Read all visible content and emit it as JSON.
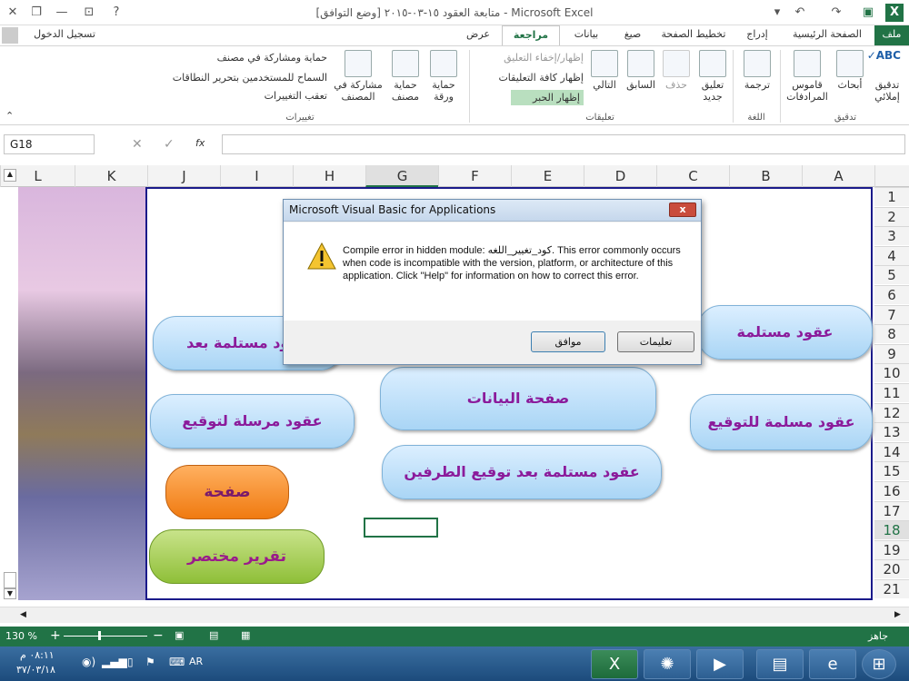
{
  "window": {
    "title": "متابعة العقود ١٥-٠٣-٢٠١٥ [وضع التوافق] - Microsoft Excel",
    "sign_in": "تسجيل الدخول"
  },
  "tabs": [
    {
      "label": "ملف"
    },
    {
      "label": "الصفحة الرئيسية"
    },
    {
      "label": "إدراج"
    },
    {
      "label": "تخطيط الصفحة"
    },
    {
      "label": "صيغ"
    },
    {
      "label": "بيانات"
    },
    {
      "label": "مراجعة"
    },
    {
      "label": "عرض"
    }
  ],
  "ribbon": {
    "spelling": "تدقيق إملائي",
    "research": "أبحاث",
    "thesaurus": "قاموس المرادفات",
    "proofing_group": "تدقيق",
    "translate": "ترجمة",
    "language_group": "اللغة",
    "new_comment": "تعليق جديد",
    "delete": "حذف",
    "previous": "السابق",
    "next": "التالي",
    "show_hide_comment": "إظهار/إخفاء التعليق",
    "show_all_comments": "إظهار كافة التعليقات",
    "show_ink": "إظهار الحبر",
    "comments_group": "تعليقات",
    "protect_sheet": "حماية ورقة",
    "protect_workbook": "حماية مصنف",
    "share_workbook": "مشاركة في المصنف",
    "protect_share": "حماية ومشاركة في مصنف",
    "allow_edit_ranges": "السماح للمستخدمين بتحرير النطاقات",
    "track_changes": "تعقب التغييرات",
    "changes_group": "تغييرات"
  },
  "formula_bar": {
    "name_box": "G18",
    "fx": "fx",
    "content": ""
  },
  "columns": [
    "A",
    "B",
    "C",
    "D",
    "E",
    "F",
    "G",
    "H",
    "I",
    "J",
    "K",
    "L"
  ],
  "rows": [
    "1",
    "2",
    "3",
    "4",
    "5",
    "6",
    "7",
    "8",
    "9",
    "10",
    "11",
    "12",
    "13",
    "14",
    "15",
    "16",
    "17",
    "18",
    "19",
    "20",
    "21"
  ],
  "buttons": {
    "b1": "عقود مستلمة",
    "b2": "عقود مستلمة بعد",
    "b3": "صفحة البيانات",
    "b4": "عقود مسلمة للتوقيع",
    "b5": "عقود مرسلة لتوقيع",
    "b6": "عقود مستلمة بعد توقيع الطرفين",
    "b7": "صفحة",
    "b8": "تقرير مختصر"
  },
  "dialog": {
    "title": "Microsoft Visual Basic for Applications",
    "message": "Compile error in hidden module: كود_تغيير_اللغه. This error commonly occurs when code is incompatible with the version, platform, or architecture of this application.  Click \"Help\" for information on how to correct this error.",
    "ok": "موافق",
    "help": "تعليمات",
    "close": "x"
  },
  "status": {
    "ready": "جاهز",
    "zoom": "130 %"
  },
  "taskbar": {
    "time": "٠٨:١١ م",
    "date": "٣٧/٠٣/١٨",
    "lang": "AR"
  }
}
